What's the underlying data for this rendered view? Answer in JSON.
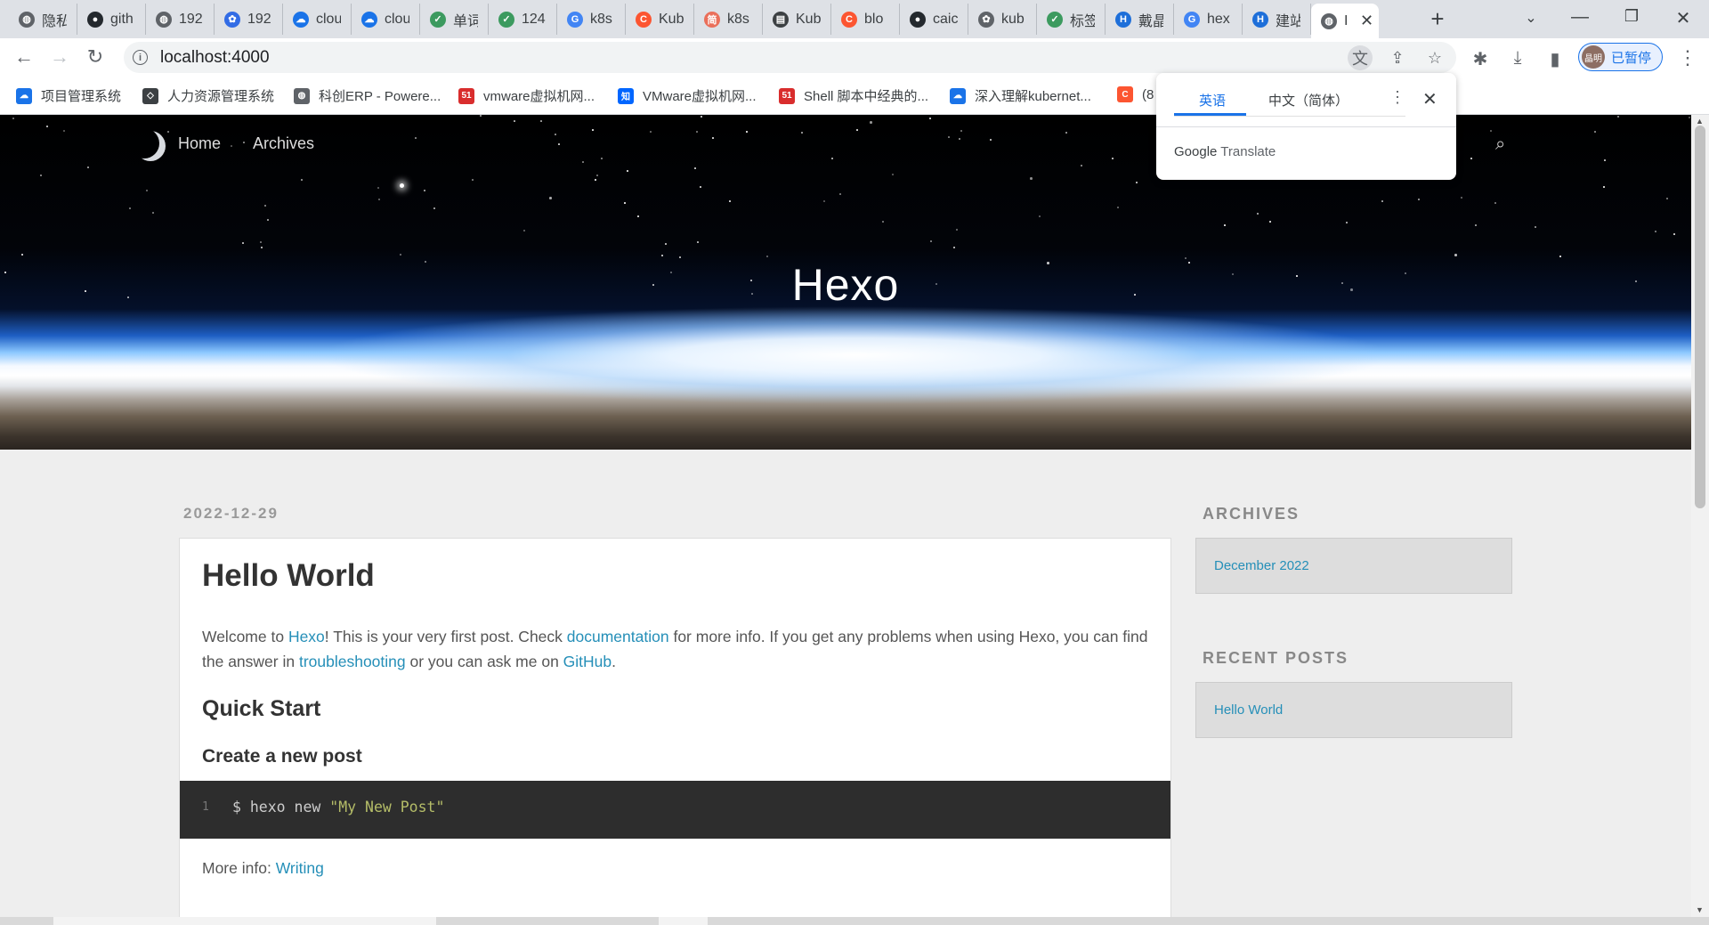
{
  "browser": {
    "tabs": [
      {
        "title": "隐私",
        "icon": "globe-icon",
        "color": "#5f6368"
      },
      {
        "title": "gith",
        "icon": "github-icon",
        "color": "#24292e"
      },
      {
        "title": "192",
        "icon": "globe-icon",
        "color": "#5f6368"
      },
      {
        "title": "192",
        "icon": "kubernetes-icon",
        "color": "#326ce5"
      },
      {
        "title": "clou",
        "icon": "cloud-icon",
        "color": "#1a73e8"
      },
      {
        "title": "clou",
        "icon": "cloud-icon",
        "color": "#1a73e8"
      },
      {
        "title": "单词",
        "icon": "check-icon",
        "color": "#3c9a5f"
      },
      {
        "title": "124",
        "icon": "check-icon",
        "color": "#3c9a5f"
      },
      {
        "title": "k8s",
        "icon": "google-icon",
        "color": "#4285f4"
      },
      {
        "title": "Kub",
        "icon": "csdn-icon",
        "color": "#fc5531"
      },
      {
        "title": "k8s",
        "icon": "jianshu-icon",
        "color": "#ea6f5a"
      },
      {
        "title": "Kub",
        "icon": "book-icon",
        "color": "#3c4043"
      },
      {
        "title": "blo",
        "icon": "csdn-icon",
        "color": "#fc5531"
      },
      {
        "title": "caic",
        "icon": "github-icon",
        "color": "#24292e"
      },
      {
        "title": "kub",
        "icon": "kubernetes-icon",
        "color": "#5f6368"
      },
      {
        "title": "标签",
        "icon": "check-icon",
        "color": "#3c9a5f"
      },
      {
        "title": "戴晶",
        "icon": "h-icon",
        "color": "#1e6fd9"
      },
      {
        "title": "hex",
        "icon": "google-icon",
        "color": "#4285f4"
      },
      {
        "title": "建站",
        "icon": "h-icon",
        "color": "#1e6fd9"
      },
      {
        "title": "I",
        "icon": "globe-icon",
        "color": "#5f6368",
        "active": true
      }
    ],
    "url": "localhost:4000",
    "profile_label": "已暂停",
    "profile_initials": "晶明",
    "bookmarks": [
      {
        "label": "项目管理系统",
        "icon": "cloud-icon",
        "color": "#1a73e8"
      },
      {
        "label": "人力资源管理系统",
        "icon": "diamond-icon",
        "color": "#3c4043"
      },
      {
        "label": "科创ERP - Powere...",
        "icon": "globe-icon",
        "color": "#5f6368"
      },
      {
        "label": "vmware虚拟机网...",
        "icon": "51cto-icon",
        "color": "#d92d2d"
      },
      {
        "label": "VMware虚拟机网...",
        "icon": "zhihu-icon",
        "color": "#0066ff"
      },
      {
        "label": "Shell 脚本中经典的...",
        "icon": "51cto-icon",
        "color": "#d92d2d"
      },
      {
        "label": "深入理解kubernet...",
        "icon": "cloud-icon",
        "color": "#1a73e8"
      },
      {
        "label": "(8",
        "icon": "csdn-icon",
        "color": "#fc5531"
      }
    ]
  },
  "translate_popup": {
    "tab_source": "英语",
    "tab_target": "中文（简体）",
    "brand_google": "Google",
    "brand_translate": "Translate"
  },
  "site": {
    "nav": {
      "home": "Home",
      "archives": "Archives"
    },
    "title": "Hexo"
  },
  "post": {
    "date": "2022-12-29",
    "title": "Hello World",
    "intro": {
      "t1": "Welcome to ",
      "l1": "Hexo",
      "t2": "! This is your very first post. Check ",
      "l2": "documentation",
      "t3": " for more info. If you get any problems when using Hexo, you can find the answer in ",
      "l3": "troubleshooting",
      "t4": " or you can ask me on ",
      "l4": "GitHub",
      "t5": "."
    },
    "h2": "Quick Start",
    "h3": "Create a new post",
    "code": {
      "line_no": "1",
      "cmd": "$ hexo new ",
      "arg": "\"My New Post\""
    },
    "more": {
      "label": "More info: ",
      "link": "Writing"
    }
  },
  "sidebar": {
    "archives_heading": "ARCHIVES",
    "archives_item": "December 2022",
    "recent_heading": "RECENT POSTS",
    "recent_item": "Hello World"
  }
}
